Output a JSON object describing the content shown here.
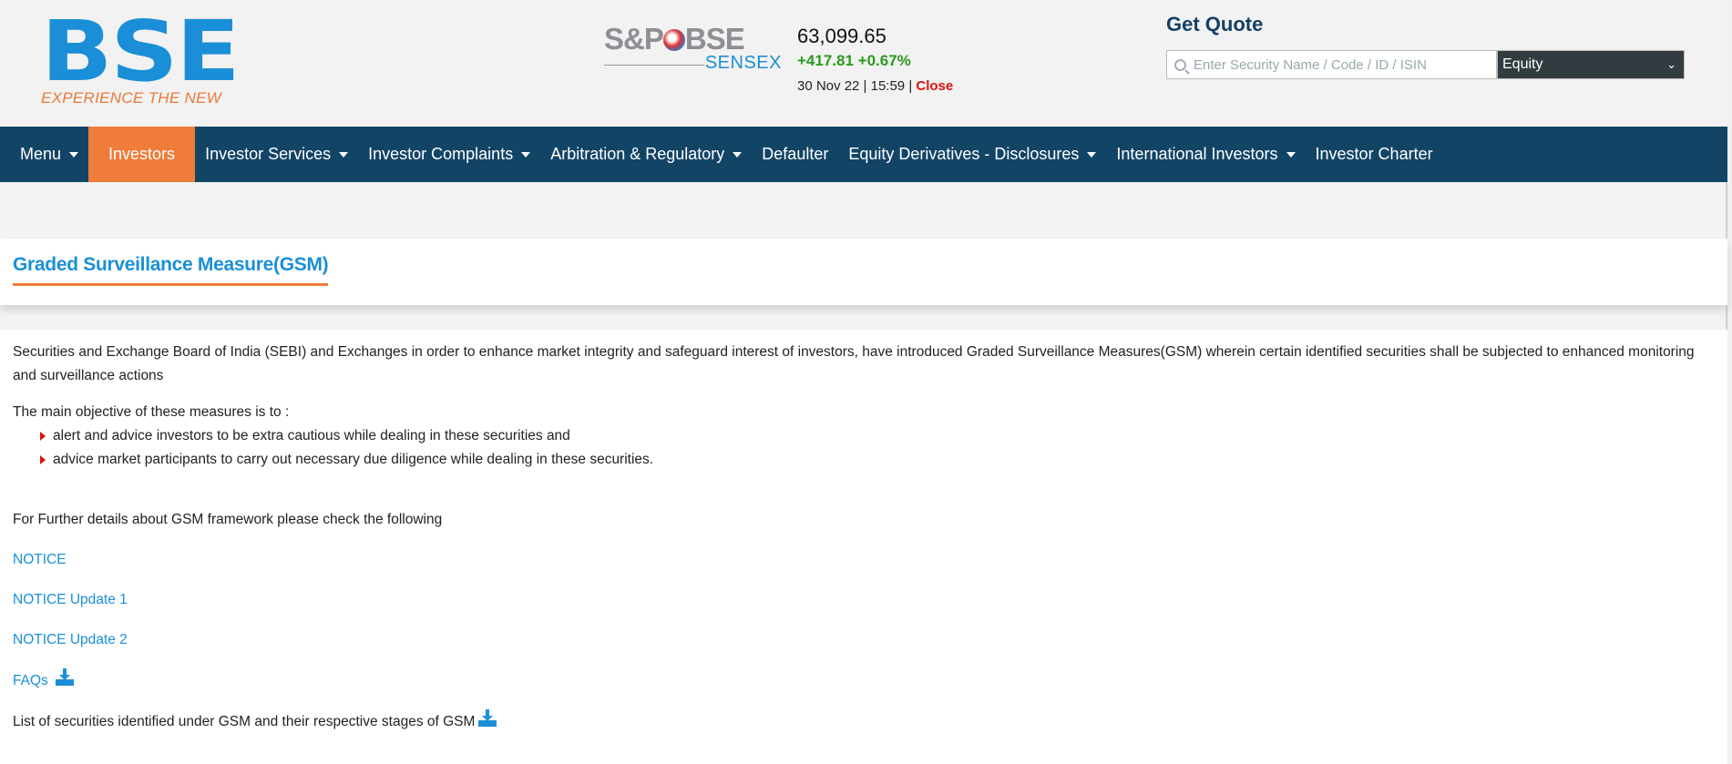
{
  "brand": {
    "logo_text": "BSE",
    "tagline": "EXPERIENCE THE NEW",
    "logo_color": "#1a8fd8",
    "tagline_color": "#e87a35"
  },
  "index": {
    "logo_sp": "S&P",
    "logo_bse": "BSE",
    "logo_sensex": "SENSEX",
    "value": "63,099.65",
    "change": "+417.81 +0.67%",
    "date_time": "30 Nov 22 | 15:59 | ",
    "status": "Close",
    "change_color": "#2a9a1c",
    "status_color": "#e01010"
  },
  "get_quote": {
    "title": "Get Quote",
    "placeholder": "Enter Security Name / Code / ID / ISIN",
    "select_value": "Equity"
  },
  "nav": {
    "items": [
      {
        "label": "Menu",
        "caret": true
      },
      {
        "label": "Investors",
        "active": true
      },
      {
        "label": "Investor Services",
        "caret": true
      },
      {
        "label": "Investor Complaints",
        "caret": true
      },
      {
        "label": "Arbitration & Regulatory",
        "caret": true
      },
      {
        "label": "Defaulter"
      },
      {
        "label": "Equity Derivatives - Disclosures",
        "caret": true
      },
      {
        "label": "International Investors",
        "caret": true
      },
      {
        "label": "Investor Charter"
      }
    ],
    "bg": "#124466",
    "active_bg": "#ef7c39"
  },
  "page": {
    "title": "Graded Surveillance Measure(GSM)",
    "intro": "Securities and Exchange Board of India (SEBI) and Exchanges in order to enhance market integrity and safeguard interest of investors, have introduced Graded Surveillance Measures(GSM) wherein certain identified securities shall be subjected to enhanced monitoring and surveillance actions",
    "objective_heading": "The main objective of these measures is to :",
    "objectives": [
      "alert and advice investors to be extra cautious while dealing in these securities and",
      "advice market participants to carry out necessary due diligence while dealing in these securities."
    ],
    "further": "For Further details about GSM framework please check the following",
    "links": {
      "notice": "NOTICE",
      "update1": "NOTICE Update 1",
      "update2": "NOTICE Update 2",
      "faqs": "FAQs"
    },
    "list_text": "List of securities identified under GSM and their respective stages of GSM"
  }
}
